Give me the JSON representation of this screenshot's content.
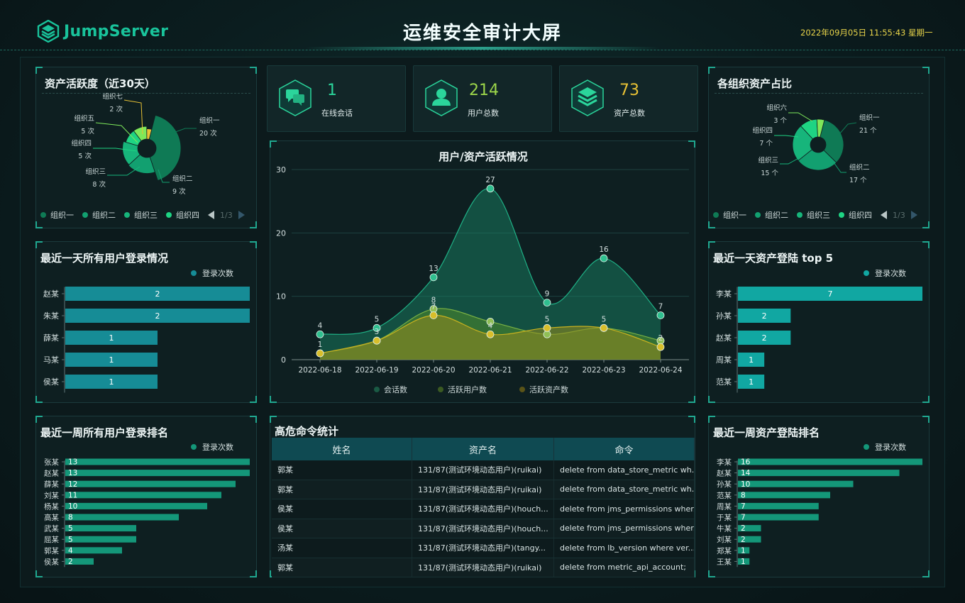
{
  "header": {
    "logo_text": "JumpServer",
    "title": "运维安全审计大屏",
    "datetime": "2022年09月05日 11:55:43 星期一"
  },
  "colors": {
    "accent": "#19c39b",
    "yellow": "#e8d44a",
    "teal_bar": "#168c96",
    "green_bar": "#149779"
  },
  "stats": [
    {
      "value": "1",
      "label": "在线会话",
      "color": "#2bd59b",
      "icon": "chat-icon"
    },
    {
      "value": "214",
      "label": "用户总数",
      "color": "#9cd64a",
      "icon": "user-icon"
    },
    {
      "value": "73",
      "label": "资产总数",
      "color": "#e8c235",
      "icon": "stack-icon"
    }
  ],
  "asset_activity": {
    "title": "资产活跃度（近30天）",
    "legend": [
      "组织一",
      "组织二",
      "组织三",
      "组织四"
    ],
    "pager": "1/3"
  },
  "org_share": {
    "title": "各组织资产占比",
    "legend": [
      "组织一",
      "组织二",
      "组织三",
      "组织四"
    ],
    "pager": "1/3"
  },
  "user_login_day": {
    "title": "最近一天所有用户登录情况",
    "legend": "登录次数"
  },
  "asset_login_top5": {
    "title": "最近一天资产登陆 top 5",
    "legend": "登录次数"
  },
  "user_login_week": {
    "title": "最近一周所有用户登录排名",
    "legend": "登录次数"
  },
  "asset_login_week": {
    "title": "最近一周资产登陆排名",
    "legend": "登录次数"
  },
  "activity_chart": {
    "title": "用户/资产活跃情况"
  },
  "danger_commands": {
    "title": "高危命令统计",
    "headers": [
      "姓名",
      "资产名",
      "命令"
    ],
    "rows": [
      [
        "郭某",
        "131/87(测试环境动态用户)(ruikai)",
        "delete from data_store_metric wh..."
      ],
      [
        "郭某",
        "131/87(测试环境动态用户)(ruikai)",
        "delete from data_store_metric wh..."
      ],
      [
        "侯某",
        "131/87(测试环境动态用户)(houch...",
        "delete from jms_permissions wher..."
      ],
      [
        "侯某",
        "131/87(测试环境动态用户)(houch...",
        "delete from jms_permissions wher..."
      ],
      [
        "汤某",
        "131/87(测试环境动态用户)(tangy...",
        "delete from lb_version where ver..."
      ],
      [
        "郭某",
        "131/87(测试环境动态用户)(ruikai)",
        "delete from metric_api_account;"
      ]
    ]
  },
  "chart_data": [
    {
      "type": "pie",
      "title": "资产活跃度（近30天）",
      "categories": [
        "组织一",
        "组织二",
        "组织三",
        "组织四",
        "组织五",
        "组织七"
      ],
      "values": [
        20,
        9,
        8,
        5,
        5,
        2
      ],
      "labels": [
        {
          "name": "组织一",
          "value": "20 次"
        },
        {
          "name": "组织二",
          "value": "9 次"
        },
        {
          "name": "组织三",
          "value": "8 次"
        },
        {
          "name": "组织四",
          "value": "5 次"
        },
        {
          "name": "组织五",
          "value": "5 次"
        },
        {
          "name": "组织七",
          "value": "2 次"
        }
      ]
    },
    {
      "type": "pie",
      "title": "各组织资产占比",
      "categories": [
        "组织一",
        "组织二",
        "组织三",
        "组织四",
        "组织六"
      ],
      "values": [
        21,
        17,
        15,
        7,
        3
      ],
      "labels": [
        {
          "name": "组织一",
          "value": "21 个"
        },
        {
          "name": "组织二",
          "value": "17 个"
        },
        {
          "name": "组织三",
          "value": "15 个"
        },
        {
          "name": "组织四",
          "value": "7 个"
        },
        {
          "name": "组织六",
          "value": "3 个"
        }
      ]
    },
    {
      "type": "bar",
      "title": "最近一天所有用户登录情况",
      "categories": [
        "赵某",
        "朱某",
        "薛某",
        "马某",
        "侯某"
      ],
      "series": [
        {
          "name": "登录次数",
          "values": [
            2,
            2,
            1,
            1,
            1
          ]
        }
      ]
    },
    {
      "type": "bar",
      "title": "最近一天资产登陆 top 5",
      "categories": [
        "李某",
        "孙某",
        "赵某",
        "周某",
        "范某"
      ],
      "series": [
        {
          "name": "登录次数",
          "values": [
            7,
            2,
            2,
            1,
            1
          ]
        }
      ]
    },
    {
      "type": "bar",
      "title": "最近一周所有用户登录排名",
      "categories": [
        "张某",
        "赵某",
        "薛某",
        "刘某",
        "杨某",
        "高某",
        "武某",
        "屈某",
        "郭某",
        "侯某"
      ],
      "series": [
        {
          "name": "登录次数",
          "values": [
            13,
            13,
            12,
            11,
            10,
            8,
            5,
            5,
            4,
            2
          ]
        }
      ]
    },
    {
      "type": "bar",
      "title": "最近一周资产登陆排名",
      "categories": [
        "李某",
        "赵某",
        "孙某",
        "范某",
        "周某",
        "于某",
        "牛某",
        "刘某",
        "郑某",
        "王某"
      ],
      "series": [
        {
          "name": "登录次数",
          "values": [
            16,
            14,
            10,
            8,
            7,
            7,
            2,
            2,
            1,
            1
          ]
        }
      ]
    },
    {
      "type": "area",
      "title": "用户/资产活跃情况",
      "x": [
        "2022-06-18",
        "2022-06-19",
        "2022-06-20",
        "2022-06-21",
        "2022-06-22",
        "2022-06-23",
        "2022-06-24"
      ],
      "ylim": [
        0,
        30
      ],
      "yticks": [
        0,
        10,
        20,
        30
      ],
      "series": [
        {
          "name": "会话数",
          "values": [
            4,
            5,
            13,
            27,
            9,
            16,
            7
          ],
          "color": "#1a8c6b"
        },
        {
          "name": "活跃用户数",
          "values": [
            1,
            3,
            8,
            6,
            4,
            5,
            3
          ],
          "color": "#4e8a2c"
        },
        {
          "name": "活跃资产数",
          "values": [
            1,
            3,
            7,
            4,
            5,
            5,
            2
          ],
          "color": "#c9b21f"
        }
      ]
    }
  ]
}
